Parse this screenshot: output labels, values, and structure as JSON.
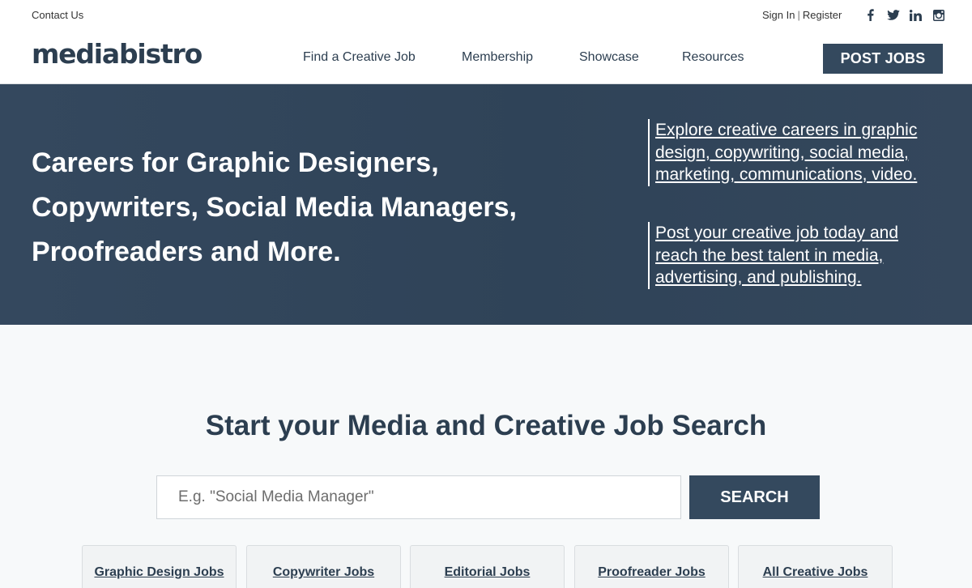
{
  "topbar": {
    "contact": "Contact Us",
    "sign_in": "Sign In",
    "separator": "|",
    "register": "Register",
    "social": [
      "facebook-icon",
      "twitter-icon",
      "linkedin-icon",
      "instagram-icon"
    ]
  },
  "header": {
    "logo": "mediabistro",
    "nav": [
      "Find a Creative Job",
      "Membership",
      "Showcase",
      "Resources"
    ],
    "cta": "POST JOBS"
  },
  "hero": {
    "title": "Careers for Graphic Designers, Copywriters, Social Media Managers, Proofreaders and More.",
    "link1": "Explore creative careers in graphic design, copywriting, social media, marketing, communications, video.",
    "link2": "Post your creative job today and reach the best talent in media, advertising, and publishing."
  },
  "search": {
    "title": "Start your Media and Creative Job Search",
    "placeholder": "E.g. \"Social Media Manager\"",
    "button": "SEARCH"
  },
  "categories": [
    "Graphic Design Jobs",
    "Copywriter Jobs",
    "Editorial Jobs",
    "Proofreader Jobs",
    "All Creative Jobs"
  ],
  "colors": {
    "primary": "#34495e",
    "text": "#2c3e50",
    "background": "#f7f9fa"
  }
}
